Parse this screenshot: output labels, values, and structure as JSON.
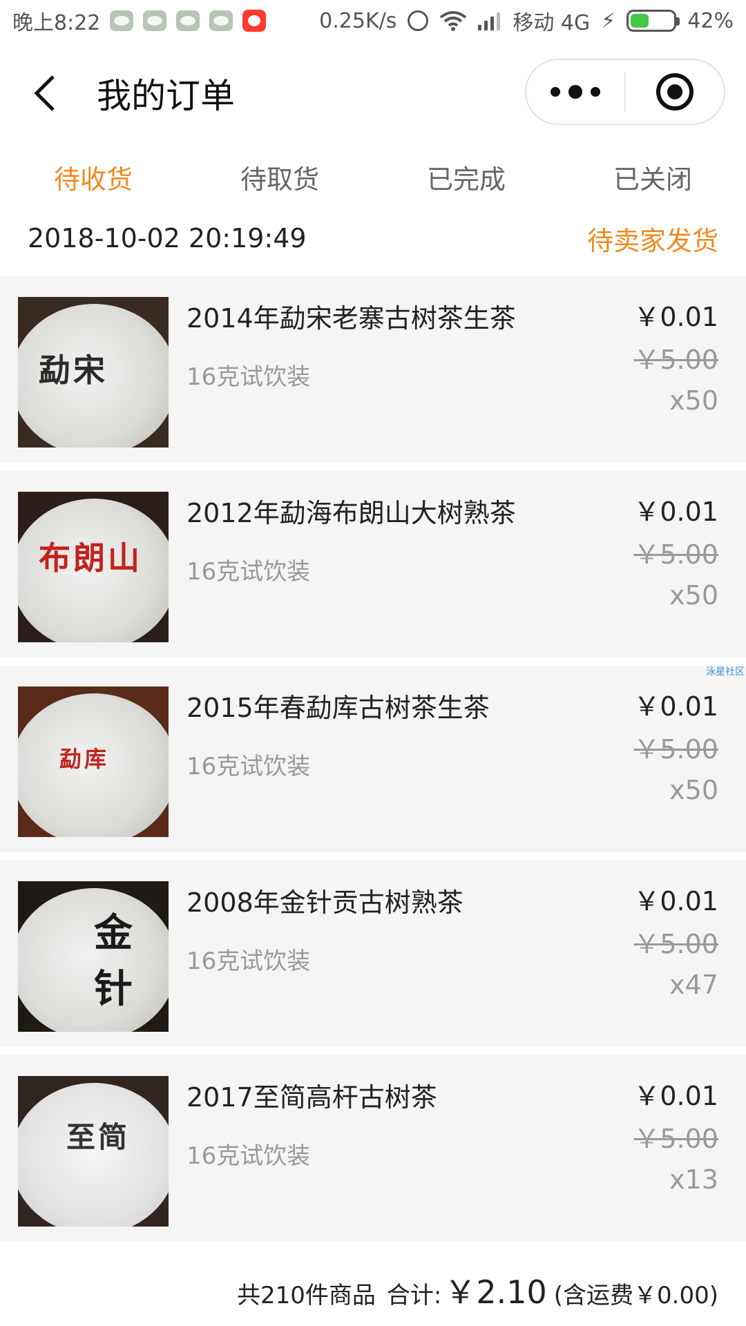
{
  "status_bar": {
    "time": "晚上8:22",
    "net_speed": "0.25K/s",
    "carrier": "移动 4G",
    "battery": "42%"
  },
  "title_bar": {
    "title": "我的订单"
  },
  "tabs": [
    {
      "label": "待收货",
      "active": true
    },
    {
      "label": "待取货",
      "active": false
    },
    {
      "label": "已完成",
      "active": false
    },
    {
      "label": "已关闭",
      "active": false
    }
  ],
  "order": {
    "time": "2018-10-02 20:19:49",
    "status": "待卖家发货",
    "items": [
      {
        "name": "2014年勐宋老寨古树茶生茶",
        "spec": "16克试饮装",
        "price": "￥0.01",
        "original_price": "￥5.00",
        "qty": "x50",
        "stamp": "勐宋"
      },
      {
        "name": "2012年勐海布朗山大树熟茶",
        "spec": "16克试饮装",
        "price": "￥0.01",
        "original_price": "￥5.00",
        "qty": "x50",
        "stamp": "布朗山"
      },
      {
        "name": "2015年春勐库古树茶生茶",
        "spec": "16克试饮装",
        "price": "￥0.01",
        "original_price": "￥5.00",
        "qty": "x50",
        "stamp": "勐库"
      },
      {
        "name": "2008年金针贡古树熟茶",
        "spec": "16克试饮装",
        "price": "￥0.01",
        "original_price": "￥5.00",
        "qty": "x47",
        "stamp": "金针"
      },
      {
        "name": "2017至简高杆古树茶",
        "spec": "16克试饮装",
        "price": "￥0.01",
        "original_price": "￥5.00",
        "qty": "x13",
        "stamp": "至简"
      }
    ]
  },
  "watermark": "泳星社区",
  "footer": {
    "count": "共210件商品",
    "total_label": "合计:",
    "total_amount": "￥2.10",
    "shipping": "(含运费￥0.00)"
  }
}
